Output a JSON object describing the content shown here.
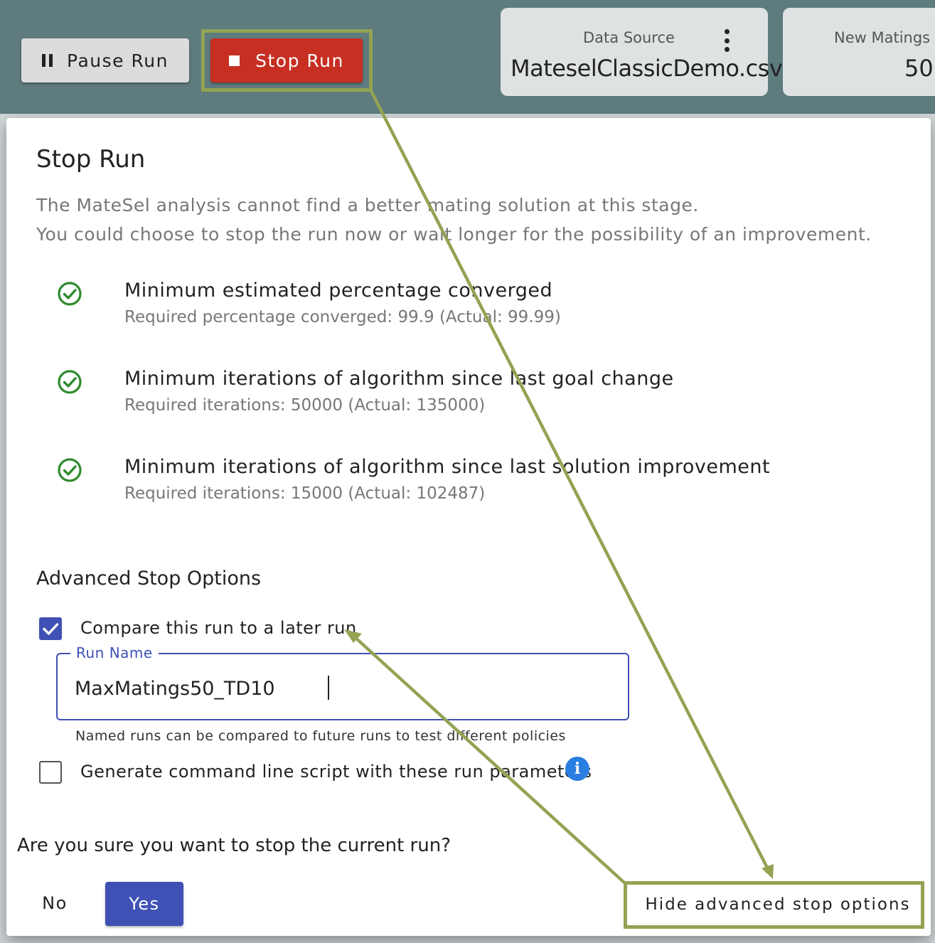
{
  "toolbar": {
    "pause_label": "Pause Run",
    "stop_label": "Stop Run"
  },
  "cards": {
    "data_source_label": "Data Source",
    "data_source_value": "MateselClassicDemo.csv",
    "new_matings_label": "New Matings P",
    "new_matings_value": "50"
  },
  "dialog": {
    "title": "Stop Run",
    "description_line1": "The MateSel analysis cannot find a better mating solution at this stage.",
    "description_line2": "You could choose to stop the run now or wait longer for the possibility of an improvement.",
    "criteria": [
      {
        "title": "Minimum estimated percentage converged",
        "detail": "Required percentage converged: 99.9 (Actual: 99.99)",
        "met": true
      },
      {
        "title": "Minimum iterations of algorithm since last goal change",
        "detail": "Required iterations: 50000 (Actual: 135000)",
        "met": true
      },
      {
        "title": "Minimum iterations of algorithm since last solution improvement",
        "detail": "Required iterations: 15000 (Actual: 102487)",
        "met": true
      }
    ],
    "advanced": {
      "heading": "Advanced Stop Options",
      "compare_label": "Compare this run to a later run",
      "compare_checked": true,
      "run_name_label": "Run Name",
      "run_name_value": "MaxMatings50_TD10",
      "run_name_hint": "Named runs can be compared to future runs to test different policies",
      "script_label": "Generate command line script with these run parameters",
      "script_checked": false
    },
    "confirm_text": "Are you sure you want to stop the current run?",
    "no_label": "No",
    "yes_label": "Yes",
    "hide_advanced_label": "Hide advanced stop options"
  },
  "colors": {
    "topbar": "#5e7b7e",
    "stop_button": "#c62f22",
    "primary": "#3f51b5",
    "success": "#2e8b2e",
    "annotation": "#93a353",
    "info": "#2a7de1"
  },
  "icons": [
    "pause-icon",
    "stop-icon",
    "kebab-menu-icon",
    "check-circle-icon",
    "checkbox-checked-icon",
    "checkbox-unchecked-icon",
    "info-icon"
  ]
}
